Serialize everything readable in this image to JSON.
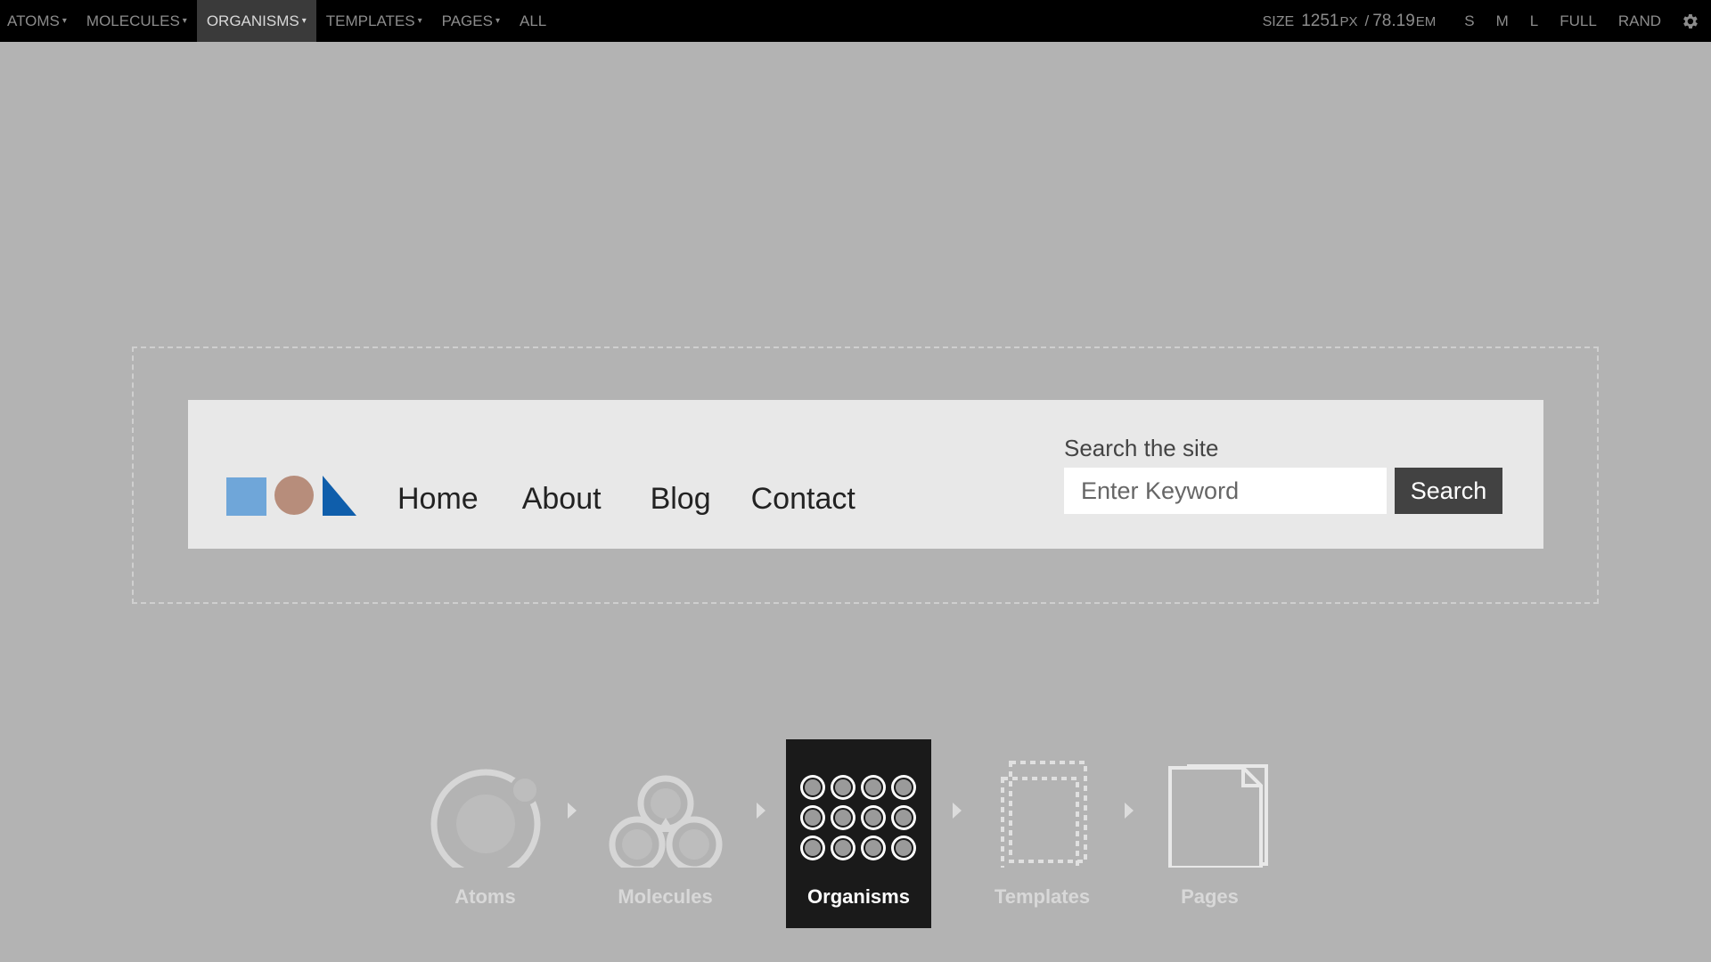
{
  "toolbar": {
    "nav": [
      {
        "label": "ATOMS",
        "has_caret": true,
        "active": false
      },
      {
        "label": "MOLECULES",
        "has_caret": true,
        "active": false
      },
      {
        "label": "ORGANISMS",
        "has_caret": true,
        "active": true
      },
      {
        "label": "TEMPLATES",
        "has_caret": true,
        "active": false
      },
      {
        "label": "PAGES",
        "has_caret": true,
        "active": false
      },
      {
        "label": "ALL",
        "has_caret": false,
        "active": false
      }
    ],
    "size_label": "SIZE",
    "size_px": "1251",
    "size_px_unit": "PX",
    "size_sep": "/",
    "size_em": "78.19",
    "size_em_unit": "EM",
    "size_buttons": [
      "S",
      "M",
      "L",
      "FULL",
      "RAND"
    ],
    "settings_icon": "gear-icon",
    "caret": "▾"
  },
  "header": {
    "logo_icon": "shapes-logo-icon",
    "logo_colors": {
      "square": "#6fa6d9",
      "circle": "#b78d7b",
      "triangle": "#0f5eab"
    },
    "nav": [
      "Home",
      "About",
      "Blog",
      "Contact"
    ],
    "search_label": "Search the site",
    "search_placeholder": "Enter Keyword",
    "search_button": "Search"
  },
  "stages": [
    {
      "label": "Atoms",
      "icon": "atom-icon",
      "active": false
    },
    {
      "label": "Molecules",
      "icon": "molecule-icon",
      "active": false
    },
    {
      "label": "Organisms",
      "icon": "organism-grid-icon",
      "active": true
    },
    {
      "label": "Templates",
      "icon": "template-dashed-icon",
      "active": false
    },
    {
      "label": "Pages",
      "icon": "pages-icon",
      "active": false
    }
  ],
  "colors": {
    "background": "#b3b3b3",
    "toolbar": "#000000",
    "toolbar_active": "#3a3a3a",
    "header_bg": "#e8e8e8",
    "button_bg": "#424242",
    "active_stage_bg": "#1a1a1a"
  }
}
